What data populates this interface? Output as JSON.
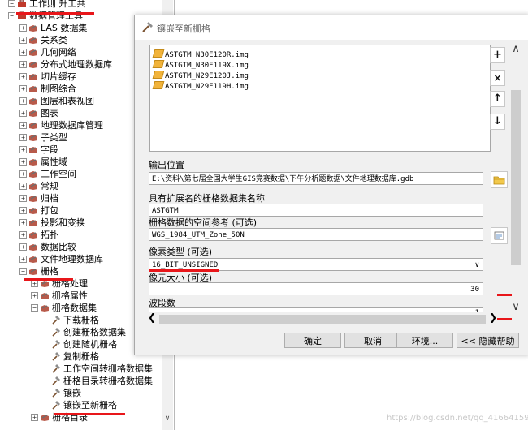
{
  "tree": {
    "items": [
      {
        "label": "工作则 升工共",
        "level": 0,
        "expander": "minus",
        "icon": "toolbox-icon"
      },
      {
        "label": "数据管理工具",
        "level": 0,
        "expander": "minus",
        "icon": "toolbox-icon"
      },
      {
        "label": "LAS 数据集",
        "level": 1,
        "expander": "plus",
        "icon": "toolset-icon"
      },
      {
        "label": "关系类",
        "level": 1,
        "expander": "plus",
        "icon": "toolset-icon"
      },
      {
        "label": "几何网络",
        "level": 1,
        "expander": "plus",
        "icon": "toolset-icon"
      },
      {
        "label": "分布式地理数据库",
        "level": 1,
        "expander": "plus",
        "icon": "toolset-icon"
      },
      {
        "label": "切片缓存",
        "level": 1,
        "expander": "plus",
        "icon": "toolset-icon"
      },
      {
        "label": "制图综合",
        "level": 1,
        "expander": "plus",
        "icon": "toolset-icon"
      },
      {
        "label": "图层和表视图",
        "level": 1,
        "expander": "plus",
        "icon": "toolset-icon"
      },
      {
        "label": "图表",
        "level": 1,
        "expander": "plus",
        "icon": "toolset-icon"
      },
      {
        "label": "地理数据库管理",
        "level": 1,
        "expander": "plus",
        "icon": "toolset-icon"
      },
      {
        "label": "子类型",
        "level": 1,
        "expander": "plus",
        "icon": "toolset-icon"
      },
      {
        "label": "字段",
        "level": 1,
        "expander": "plus",
        "icon": "toolset-icon"
      },
      {
        "label": "属性域",
        "level": 1,
        "expander": "plus",
        "icon": "toolset-icon"
      },
      {
        "label": "工作空间",
        "level": 1,
        "expander": "plus",
        "icon": "toolset-icon"
      },
      {
        "label": "常规",
        "level": 1,
        "expander": "plus",
        "icon": "toolset-icon"
      },
      {
        "label": "归档",
        "level": 1,
        "expander": "plus",
        "icon": "toolset-icon"
      },
      {
        "label": "打包",
        "level": 1,
        "expander": "plus",
        "icon": "toolset-icon"
      },
      {
        "label": "投影和变换",
        "level": 1,
        "expander": "plus",
        "icon": "toolset-icon"
      },
      {
        "label": "拓扑",
        "level": 1,
        "expander": "plus",
        "icon": "toolset-icon"
      },
      {
        "label": "数据比较",
        "level": 1,
        "expander": "plus",
        "icon": "toolset-icon"
      },
      {
        "label": "文件地理数据库",
        "level": 1,
        "expander": "plus",
        "icon": "toolset-icon"
      },
      {
        "label": "栅格",
        "level": 1,
        "expander": "minus",
        "icon": "toolset-icon"
      },
      {
        "label": "栅格处理",
        "level": 2,
        "expander": "plus",
        "icon": "toolset-icon"
      },
      {
        "label": "栅格属性",
        "level": 2,
        "expander": "plus",
        "icon": "toolset-icon"
      },
      {
        "label": "栅格数据集",
        "level": 2,
        "expander": "minus",
        "icon": "toolset-icon"
      },
      {
        "label": "下载栅格",
        "level": 3,
        "expander": "",
        "icon": "hammer-icon"
      },
      {
        "label": "创建栅格数据集",
        "level": 3,
        "expander": "",
        "icon": "hammer-icon"
      },
      {
        "label": "创建随机栅格",
        "level": 3,
        "expander": "",
        "icon": "hammer-icon"
      },
      {
        "label": "复制栅格",
        "level": 3,
        "expander": "",
        "icon": "hammer-icon"
      },
      {
        "label": "工作空间转栅格数据集",
        "level": 3,
        "expander": "",
        "icon": "hammer-icon"
      },
      {
        "label": "栅格目录转栅格数据集",
        "level": 3,
        "expander": "",
        "icon": "hammer-icon"
      },
      {
        "label": "镶嵌",
        "level": 3,
        "expander": "",
        "icon": "hammer-icon"
      },
      {
        "label": "镶嵌至新栅格",
        "level": 3,
        "expander": "",
        "icon": "hammer-icon"
      },
      {
        "label": "栅格目录",
        "level": 2,
        "expander": "plus",
        "icon": "toolset-icon"
      }
    ]
  },
  "dialog": {
    "title": "镶嵌至新栅格",
    "input_rasters": [
      "ASTGTM_N30E120R.img",
      "ASTGTM_N30E119X.img",
      "ASTGTM_N29E120J.img",
      "ASTGTM_N29E119H.img"
    ],
    "side_buttons": {
      "add": "+",
      "remove": "×",
      "up": "↑",
      "down": "↓"
    },
    "output_location": {
      "label": "输出位置",
      "value": "E:\\资料\\第七届全国大学生GIS竞赛数据\\下午分析题数据\\文件地理数据库.gdb"
    },
    "dataset_name": {
      "label": "具有扩展名的栅格数据集名称",
      "value": "ASTGTM"
    },
    "spatial_ref": {
      "label": "栅格数据的空间参考 (可选)",
      "value": "WGS_1984_UTM_Zone_50N"
    },
    "pixel_type": {
      "label": "像素类型 (可选)",
      "value": "16_BIT_UNSIGNED"
    },
    "cellsize": {
      "label": "像元大小 (可选)",
      "value": "30"
    },
    "bands": {
      "label": "波段数",
      "value": "1"
    },
    "buttons": {
      "ok": "确定",
      "cancel": "取消",
      "env": "环境...",
      "help": "<< 隐藏帮助"
    }
  },
  "watermark": "https://blog.csdn.net/qq_41664159",
  "colors": {
    "annotation_red": "#e8161a",
    "toolbox_red": "#c0392b",
    "file_icon": "#f1b33a"
  }
}
